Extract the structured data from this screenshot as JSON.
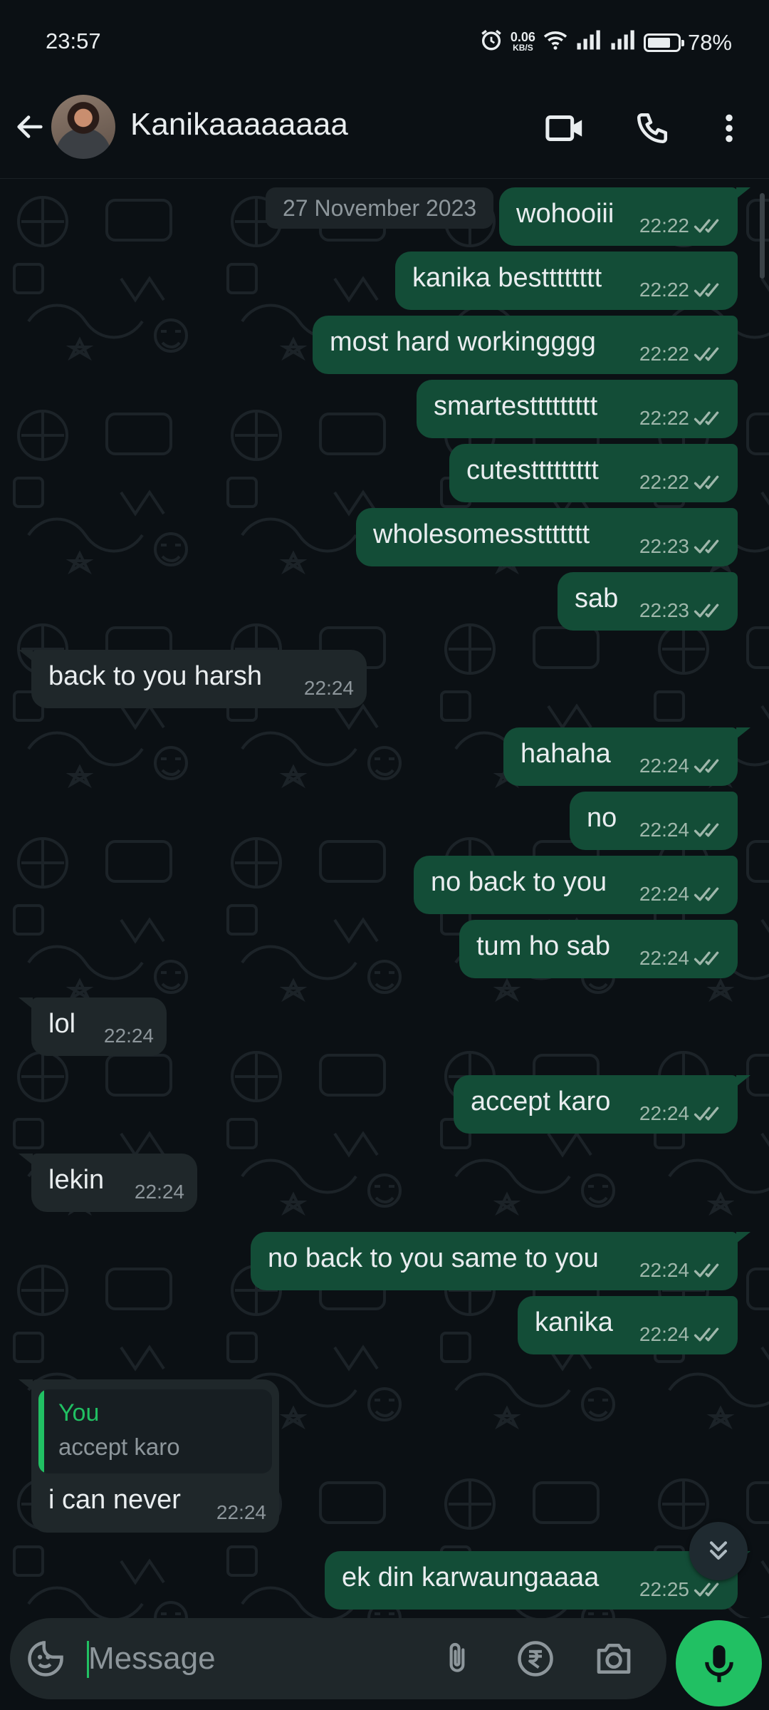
{
  "status_bar": {
    "time": "23:57",
    "net_speed_value": "0.06",
    "net_speed_unit": "KB/S",
    "battery": "78%",
    "battery_level": 0.78,
    "icons": [
      "alarm-icon",
      "wifi-icon",
      "signal-icon",
      "signal-icon",
      "battery-icon"
    ]
  },
  "header": {
    "contact_name": "Kanikaaaaaaaa",
    "icons": [
      "back-arrow-icon",
      "video-call-icon",
      "phone-icon",
      "more-options-icon"
    ]
  },
  "chat": {
    "date_chip": "27 November 2023",
    "messages": [
      {
        "dir": "out",
        "text": "wohooiii",
        "time": "22:22",
        "status": "read"
      },
      {
        "dir": "out",
        "text": "kanika bestttttttt",
        "time": "22:22",
        "status": "read"
      },
      {
        "dir": "out",
        "text": "most hard workingggg",
        "time": "22:22",
        "status": "read"
      },
      {
        "dir": "out",
        "text": "smartesttttttttt",
        "time": "22:22",
        "status": "read"
      },
      {
        "dir": "out",
        "text": "cutesttttttttt",
        "time": "22:22",
        "status": "read"
      },
      {
        "dir": "out",
        "text": "wholesomessttttttt",
        "time": "22:23",
        "status": "read"
      },
      {
        "dir": "out",
        "text": "sab",
        "time": "22:23",
        "status": "read"
      },
      {
        "dir": "in",
        "text": "back to you harsh",
        "time": "22:24"
      },
      {
        "dir": "out",
        "text": "hahaha",
        "time": "22:24",
        "status": "read"
      },
      {
        "dir": "out",
        "text": "no",
        "time": "22:24",
        "status": "read"
      },
      {
        "dir": "out",
        "text": "no back to you",
        "time": "22:24",
        "status": "read"
      },
      {
        "dir": "out",
        "text": "tum ho sab",
        "time": "22:24",
        "status": "read"
      },
      {
        "dir": "in",
        "text": "lol",
        "time": "22:24"
      },
      {
        "dir": "out",
        "text": "accept karo",
        "time": "22:24",
        "status": "read"
      },
      {
        "dir": "in",
        "text": "lekin",
        "time": "22:24"
      },
      {
        "dir": "out",
        "text": "no back to you same to you",
        "time": "22:24",
        "status": "read"
      },
      {
        "dir": "out",
        "text": "kanika",
        "time": "22:24",
        "status": "read"
      },
      {
        "dir": "in",
        "text": "i can never",
        "time": "22:24",
        "reply_author": "You",
        "reply_text": "accept karo"
      },
      {
        "dir": "out",
        "text": "ek din karwaungaaaa",
        "time": "22:25",
        "status": "read"
      }
    ]
  },
  "input": {
    "placeholder": "Message",
    "value": "",
    "icons": [
      "sticker-icon",
      "attach-icon",
      "rupee-payment-icon",
      "camera-icon",
      "mic-icon",
      "scroll-down-icon"
    ]
  },
  "colors": {
    "background": "#0b1014",
    "outgoing_bubble": "#134d37",
    "incoming_bubble": "#1f272a",
    "accent_green": "#21c063",
    "read_ticks": "#9fb7ab"
  }
}
